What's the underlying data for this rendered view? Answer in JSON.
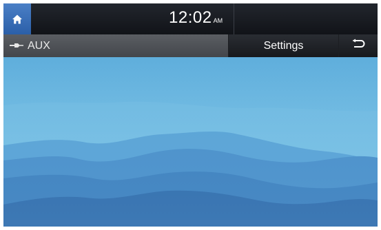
{
  "status_bar": {
    "home_icon": "home-icon",
    "time": "12:02",
    "ampm": "AM"
  },
  "source_bar": {
    "source_icon": "aux-cable-icon",
    "source_label": "AUX",
    "settings_label": "Settings",
    "back_icon": "back-arrow-icon"
  },
  "wallpaper": {
    "description_icon": "mountain-landscape"
  },
  "colors": {
    "accent": "#3f72b8",
    "status_bar": "#15181d",
    "source_active": "#4f5257",
    "sky": "#6fb6df"
  }
}
